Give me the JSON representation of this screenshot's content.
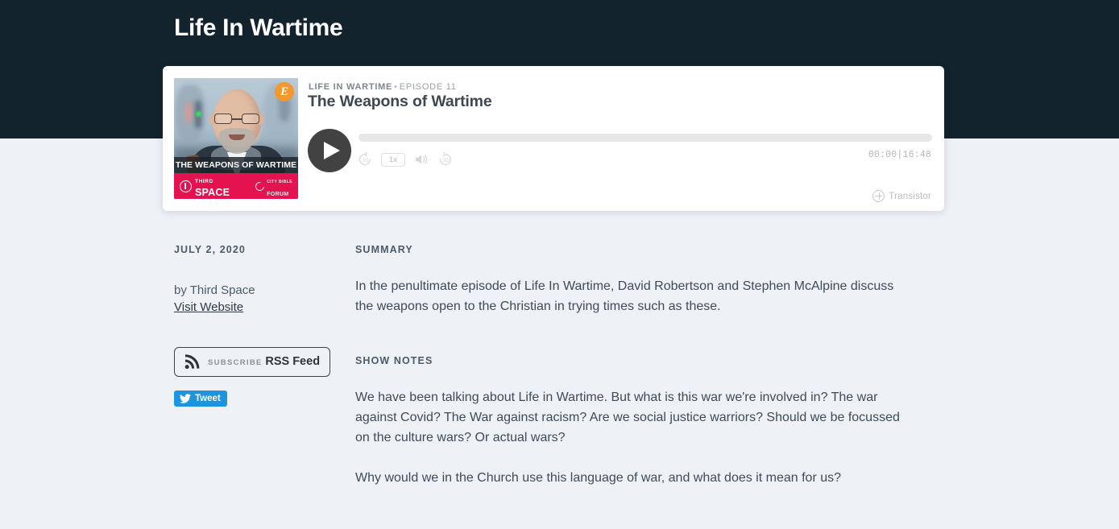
{
  "header": {
    "title": "Life In Wartime",
    "background_color": "#13232e"
  },
  "player": {
    "show_name": "LIFE IN WARTIME",
    "separator": "•",
    "episode_label": "EPISODE 11",
    "episode_title": "The Weapons of Wartime",
    "play_button_label": "Play",
    "rewind_label": "10",
    "speed_label": "1x",
    "volume_label": "Volume",
    "forward_label": "30",
    "time_display": "00:00|16:48",
    "progress_percent": 0,
    "provider_name": "Transistor",
    "artwork": {
      "badge_letter": "E",
      "badge_color": "#f2982e",
      "strip_title": "THE WEAPONS OF WARTIME",
      "brand_small": "THIRD",
      "brand_large": "SPACE",
      "partner_small": "CITY BIBLE",
      "partner_large": "FORUM",
      "footer_color": "#e4134f"
    }
  },
  "meta": {
    "published_date": "JULY 2, 2020",
    "byline": "by Third Space",
    "visit_website_label": "Visit Website",
    "rss": {
      "subscribe_label": "SUBSCRIBE",
      "feed_label": "RSS Feed"
    },
    "tweet_label": "Tweet",
    "tweet_color": "#1b95e0"
  },
  "content": {
    "summary_label": "SUMMARY",
    "summary_text": "In the penultimate episode of Life In Wartime, David Robertson and Stephen McAlpine discuss the weapons open to the Christian in trying times such as these.",
    "show_notes_label": "SHOW NOTES",
    "show_notes_paragraph_1": "We have been talking about Life in Wartime. But what is this war we're involved in? The war against Covid? The War against racism? Are we social justice warriors? Should we be focussed on the culture wars? Or actual wars?",
    "show_notes_paragraph_2": "Why would we in the Church use this language of war, and what does it mean for us?"
  }
}
